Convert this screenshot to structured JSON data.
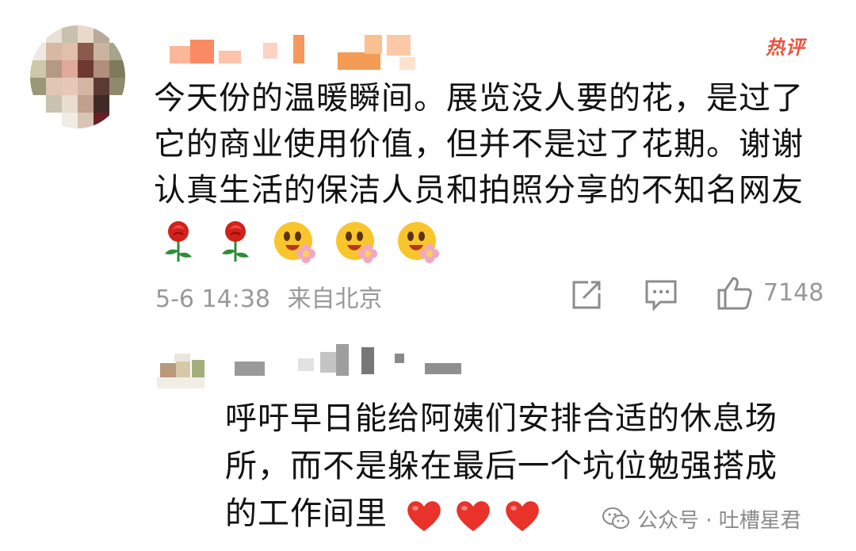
{
  "comment": {
    "badge": "热评",
    "text_line1": "今天份的温暖瞬间。展览没人要的花，是过了",
    "text_line2": "它的商业使用价值，但并不是过了花期。谢谢",
    "text_line3": "认真生活的保洁人员和拍照分享的不知名网友",
    "emojis": [
      "rose",
      "rose",
      "smile-flower",
      "smile-flower",
      "smile-flower"
    ],
    "timestamp": "5-6 14:38",
    "location": "来自北京",
    "like_count": "7148"
  },
  "reply": {
    "text_line1": "呼吁早日能给阿姨们安排合适的休息场",
    "text_line2": "所，而不是躲在最后一个坑位勉强搭成",
    "text_line3": "的工作间里",
    "emojis": [
      "heart",
      "heart",
      "heart"
    ]
  },
  "watermark": {
    "text": "公众号 · 吐槽星君"
  },
  "colors": {
    "badge": "#e8553f",
    "meta": "#999999",
    "text": "#111111",
    "heart": "#e8322a"
  }
}
